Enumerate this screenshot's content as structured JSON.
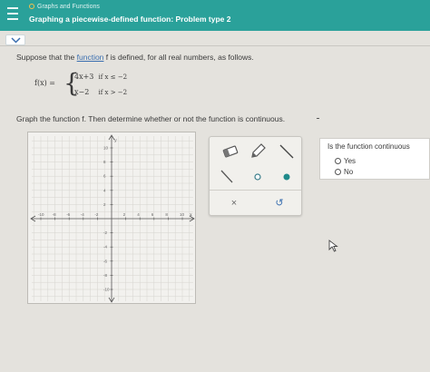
{
  "header": {
    "breadcrumb": "Graphs and Functions",
    "title": "Graphing a piecewise-defined function: Problem type 2",
    "color": "#2aa19a"
  },
  "question": {
    "intro_before": "Suppose that the ",
    "intro_link": "function",
    "intro_after": " f is defined, for all real numbers, as follows.",
    "fx": "f(x) =",
    "case1_expr": "4x+3",
    "case1_cond": "if x ≤ −2",
    "case2_expr": "x−2",
    "case2_cond": "if x > −2",
    "instruction": "Graph the function f. Then determine whether or not the function is continuous."
  },
  "graph": {
    "x_ticks": [
      "-10",
      "-8",
      "-6",
      "-4",
      "-2",
      "2",
      "4",
      "6",
      "8",
      "10"
    ],
    "y_ticks": [
      "10",
      "8",
      "6",
      "4",
      "2",
      "-2",
      "-4",
      "-6",
      "-8",
      "-10"
    ],
    "x_axis_label": "x",
    "y_axis_label": "y",
    "range": [
      -10,
      10
    ]
  },
  "tools": {
    "icons": [
      "eraser-icon",
      "pencil-icon",
      "line-tool-icon",
      "segment-tool-icon",
      "open-point-icon",
      "closed-point-icon"
    ],
    "clear_label": "×",
    "undo_label": "↺"
  },
  "answer": {
    "question": "Is the function continuous",
    "options": [
      "Yes",
      "No"
    ]
  }
}
